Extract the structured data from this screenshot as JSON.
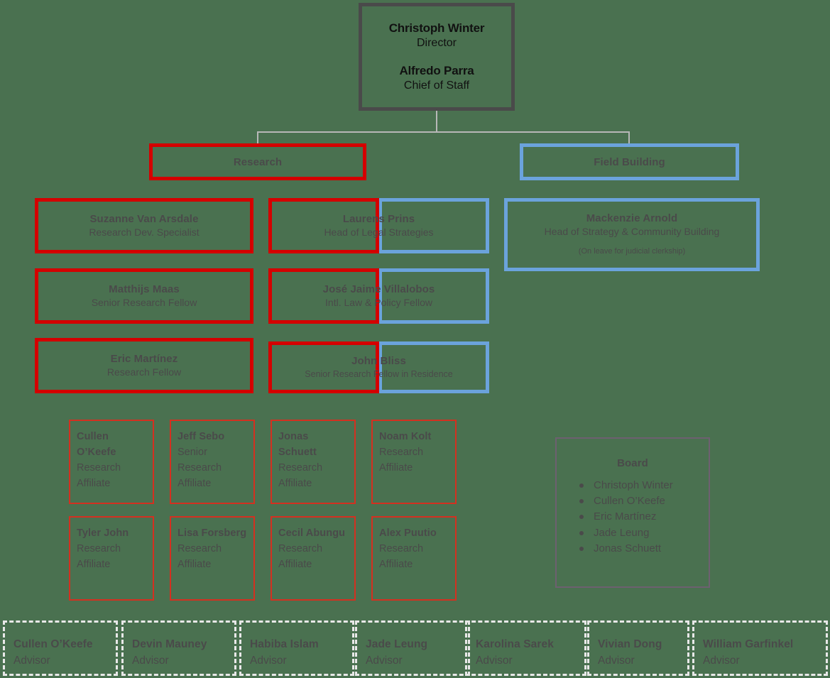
{
  "colors": {
    "background": "#4a7150",
    "research_red": "#d40000",
    "field_blue": "#6ba3dc",
    "root_gray": "#4a4a4a",
    "board_border": "#6d6070",
    "advisor_border": "#e8e8e8",
    "connector": "#b8b8b8",
    "text": "#4a4a4a"
  },
  "root": {
    "person1_name": "Christoph Winter",
    "person1_role": "Director",
    "person2_name": "Alfredo Parra",
    "person2_role": "Chief of Staff"
  },
  "divisions": {
    "research_label": "Research",
    "field_building_label": "Field Building"
  },
  "research_left": [
    {
      "name": "Suzanne Van Arsdale",
      "role": "Research Dev. Specialist"
    },
    {
      "name": "Matthijs Maas",
      "role": "Senior Research Fellow"
    },
    {
      "name": "Eric Martínez",
      "role": "Research Fellow"
    }
  ],
  "research_middle": [
    {
      "name": "Laurens Prins",
      "role": "Head of Legal Strategies"
    },
    {
      "name": "José Jaime Villalobos",
      "role": "Intl. Law & Policy Fellow"
    },
    {
      "name": "John Bliss",
      "role": "Senior Research Fellow in Residence"
    }
  ],
  "field_building": [
    {
      "name": "Mackenzie Arnold",
      "role": "Head of Strategy & Community Building",
      "note": "(On leave for judicial clerkship)"
    }
  ],
  "affiliates": [
    {
      "name": "Cullen O’Keefe",
      "role": "Research Affiliate"
    },
    {
      "name": "Jeff Sebo",
      "role": "Senior Research Affiliate"
    },
    {
      "name": "Jonas Schuett",
      "role": "Research Affiliate"
    },
    {
      "name": "Noam Kolt",
      "role": "Research Affiliate"
    },
    {
      "name": "Tyler John",
      "role": "Research Affiliate"
    },
    {
      "name": "Lisa Forsberg",
      "role": "Research Affiliate"
    },
    {
      "name": "Cecil Abungu",
      "role": "Research Affiliate"
    },
    {
      "name": "Alex Puutio",
      "role": "Research Affiliate"
    }
  ],
  "board": {
    "title": "Board",
    "members": [
      "Christoph Winter",
      "Cullen O’Keefe",
      "Eric Martínez",
      "Jade Leung",
      "Jonas Schuett"
    ]
  },
  "advisors": [
    {
      "name": "Cullen O’Keefe",
      "role": "Advisor"
    },
    {
      "name": "Devin Mauney",
      "role": "Advisor"
    },
    {
      "name": "Habiba Islam",
      "role": "Advisor"
    },
    {
      "name": "Jade Leung",
      "role": "Advisor"
    },
    {
      "name": "Karolina Sarek",
      "role": "Advisor"
    },
    {
      "name": "Vivian Dong",
      "role": "Advisor"
    },
    {
      "name": "William Garfinkel",
      "role": "Advisor"
    }
  ]
}
